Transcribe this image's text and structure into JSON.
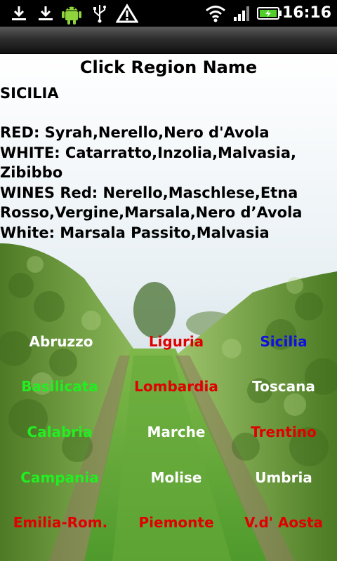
{
  "status_bar": {
    "time": "16:16",
    "icons": [
      "download-icon",
      "download-icon",
      "android-icon",
      "usb-icon",
      "warning-icon",
      "wifi-icon",
      "signal-icon",
      "battery-charging-icon"
    ]
  },
  "heading": "Click Region Name",
  "selected_region": {
    "name": "SICILIA",
    "info": "RED: Syrah,Nerello,Nero d'Avola\nWHITE: Catarratto,Inzolia,Malvasia,\nZibibbo\nWINES Red: Nerello,Maschlese,Etna\nRosso,Vergine,Marsala,Nero d’Avola\nWhite: Marsala Passito,Malvasia"
  },
  "regions": [
    {
      "label": "Abruzzo",
      "color": "#ffffff"
    },
    {
      "label": "Liguria",
      "color": "#e00000"
    },
    {
      "label": "Sicilia",
      "color": "#1010e0"
    },
    {
      "label": "Basilicata",
      "color": "#22ee22"
    },
    {
      "label": "Lombardia",
      "color": "#e00000"
    },
    {
      "label": "Toscana",
      "color": "#ffffff"
    },
    {
      "label": "Calabria",
      "color": "#22ee22"
    },
    {
      "label": "Marche",
      "color": "#ffffff"
    },
    {
      "label": "Trentino",
      "color": "#e00000"
    },
    {
      "label": "Campania",
      "color": "#22ee22"
    },
    {
      "label": "Molise",
      "color": "#ffffff"
    },
    {
      "label": "Umbria",
      "color": "#ffffff"
    },
    {
      "label": "Emilia-Rom.",
      "color": "#e00000"
    },
    {
      "label": "Piemonte",
      "color": "#e00000"
    },
    {
      "label": "V.d' Aosta",
      "color": "#e00000"
    }
  ]
}
